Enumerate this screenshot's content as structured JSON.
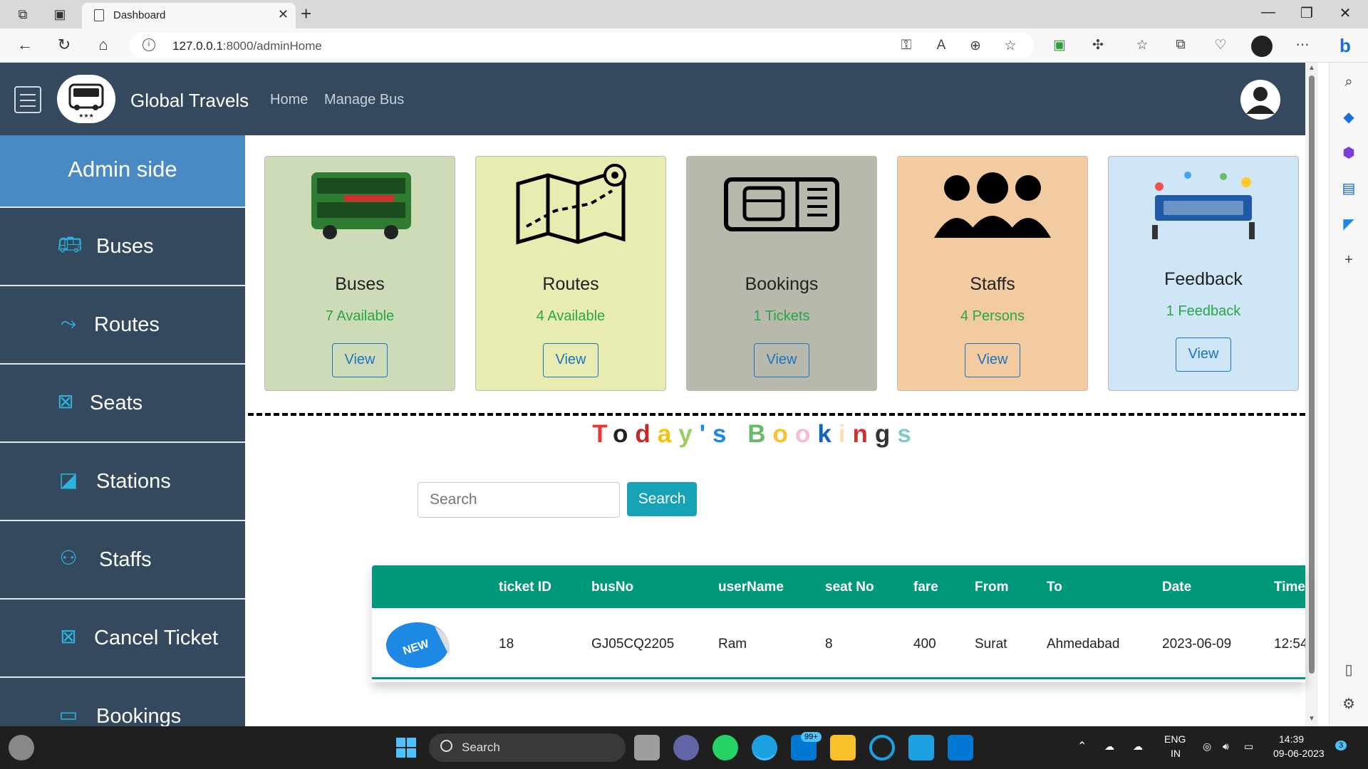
{
  "browser": {
    "tab_title": "Dashboard",
    "url_host": "127.0.0.1",
    "url_path": ":8000/adminHome"
  },
  "navbar": {
    "brand": "Global Travels",
    "links": [
      "Home",
      "Manage Bus"
    ]
  },
  "sidebar": {
    "header": "Admin side",
    "items": [
      {
        "label": "Buses",
        "icon": "bus-icon"
      },
      {
        "label": "Routes",
        "icon": "route-icon"
      },
      {
        "label": "Seats",
        "icon": "seat-icon"
      },
      {
        "label": "Stations",
        "icon": "station-icon"
      },
      {
        "label": "Staffs",
        "icon": "people-icon"
      },
      {
        "label": "Cancel Ticket",
        "icon": "cancel-icon"
      },
      {
        "label": "Bookings",
        "icon": "ticket-icon"
      }
    ]
  },
  "cards": [
    {
      "title": "Buses",
      "subtitle": "7 Available",
      "button": "View",
      "color": "#cddbb9",
      "icon": "double-decker-bus-image"
    },
    {
      "title": "Routes",
      "subtitle": "4 Available",
      "button": "View",
      "color": "#e8ecb0",
      "icon": "map-icon"
    },
    {
      "title": "Bookings",
      "subtitle": "1 Tickets",
      "button": "View",
      "color": "#b8b8ac",
      "icon": "bus-ticket-icon"
    },
    {
      "title": "Staffs",
      "subtitle": "4 Persons",
      "button": "View",
      "color": "#f3cba1",
      "icon": "group-icon"
    },
    {
      "title": "Feedback",
      "subtitle": "1 Feedback",
      "button": "View",
      "color": "#cfe6f7",
      "icon": "feedback-image"
    }
  ],
  "today": {
    "letters": [
      {
        "ch": "T",
        "color": "#e53935"
      },
      {
        "ch": "o",
        "color": "#222222"
      },
      {
        "ch": "d",
        "color": "#c62828"
      },
      {
        "ch": "a",
        "color": "#f4c20d"
      },
      {
        "ch": "y",
        "color": "#9ccc65"
      },
      {
        "ch": "'s",
        "color": "#1e88e5"
      },
      {
        "ch": " ",
        "color": "#000000"
      },
      {
        "ch": "B",
        "color": "#66bb6a"
      },
      {
        "ch": "o",
        "color": "#fbc02d"
      },
      {
        "ch": "o",
        "color": "#f8bbd0"
      },
      {
        "ch": "k",
        "color": "#1565c0"
      },
      {
        "ch": "i",
        "color": "#ffe0b2"
      },
      {
        "ch": "n",
        "color": "#d32f2f"
      },
      {
        "ch": "g",
        "color": "#333333"
      },
      {
        "ch": "s",
        "color": "#80cbc4"
      }
    ]
  },
  "search": {
    "placeholder": "Search",
    "button": "Search"
  },
  "table": {
    "headers": [
      "ticket ID",
      "busNo",
      "userName",
      "seat No",
      "fare",
      "From",
      "To",
      "Date",
      "Time"
    ],
    "badge": "NEW",
    "rows": [
      [
        "18",
        "GJ05CQ2205",
        "Ram",
        "8",
        "400",
        "Surat",
        "Ahmedabad",
        "2023-06-09",
        "12:54"
      ]
    ]
  },
  "taskbar": {
    "search_label": "Search",
    "mail_badge": "99+",
    "lang_top": "ENG",
    "lang_bottom": "IN",
    "time": "14:39",
    "date": "09-06-2023",
    "notif_count": "3"
  }
}
